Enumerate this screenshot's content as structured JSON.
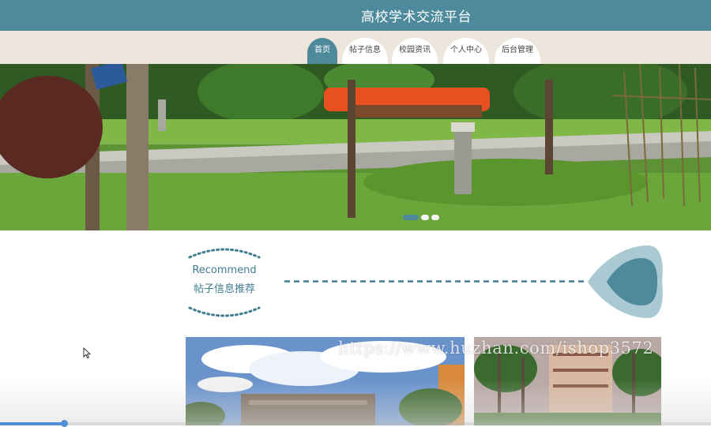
{
  "header": {
    "title": "高校学术交流平台"
  },
  "nav": {
    "items": [
      {
        "label": "首页",
        "active": true
      },
      {
        "label": "帖子信息",
        "active": false
      },
      {
        "label": "校园资讯",
        "active": false
      },
      {
        "label": "个人中心",
        "active": false
      },
      {
        "label": "后台管理",
        "active": false
      }
    ]
  },
  "carousel": {
    "slide_count": 3,
    "active_index": 0
  },
  "recommend": {
    "title_en": "Recommend",
    "title_zh": "帖子信息推荐"
  },
  "watermark": {
    "text": "https://www.huzhan.com/ishop3572"
  },
  "video": {
    "progress": 0.09
  },
  "colors": {
    "brand": "#4d8a9c",
    "nav_bg": "#ede6dc",
    "accent_light": "#a9c9d3"
  }
}
